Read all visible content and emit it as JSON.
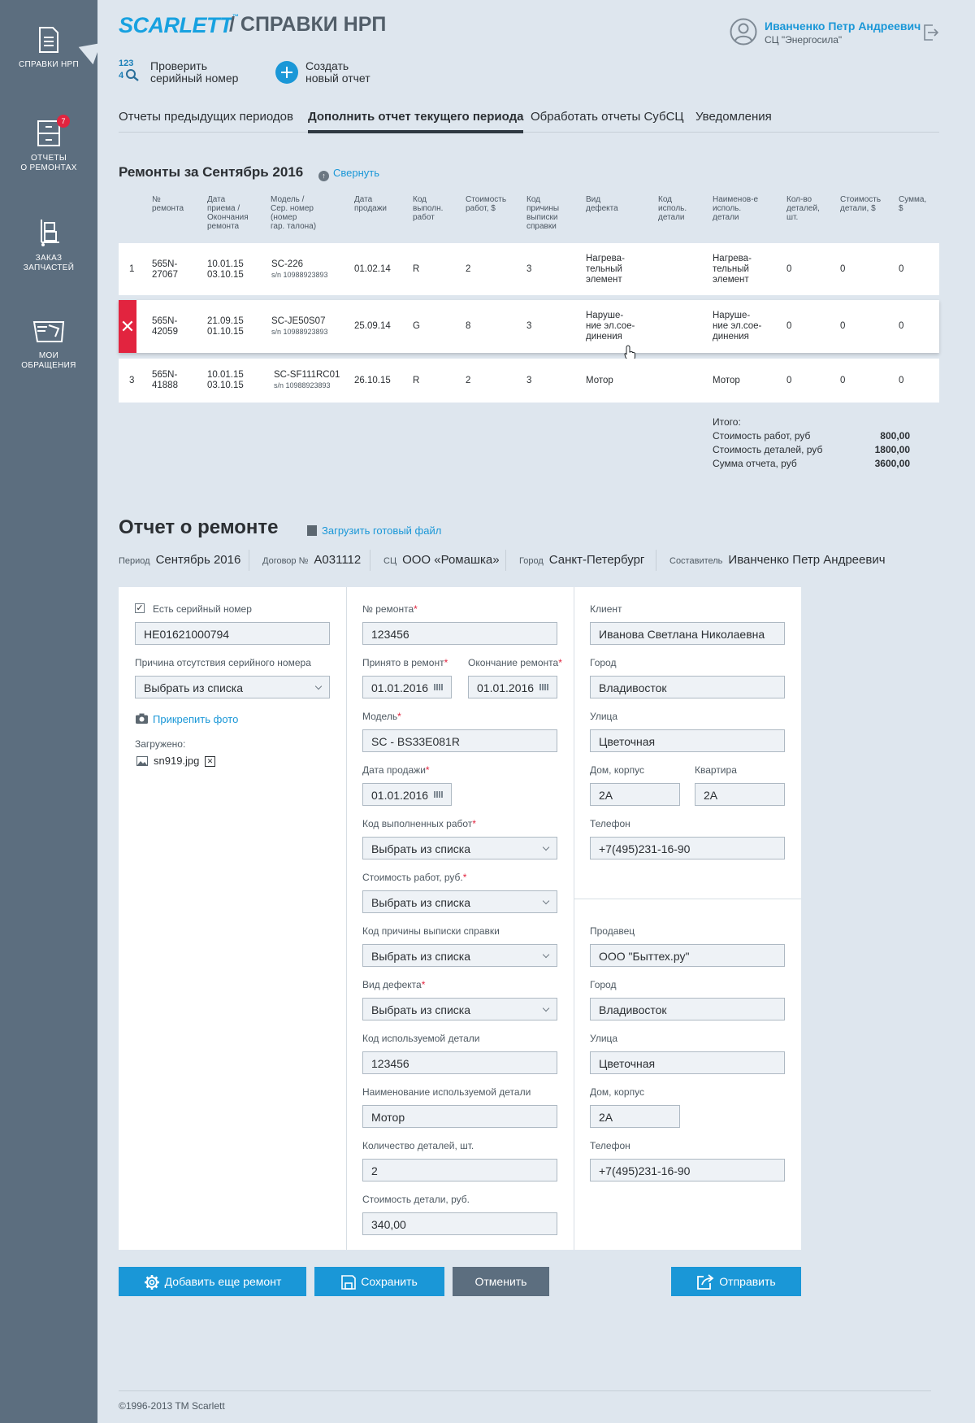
{
  "sidebar": {
    "items": [
      {
        "label": "СПРАВКИ НРП",
        "icon": "document-icon"
      },
      {
        "label": "ОТЧЕТЫ\nО РЕМОНТАХ",
        "icon": "cabinet-icon",
        "badge": "7"
      },
      {
        "label": "ЗАКАЗ\nЗАПЧАСТЕЙ",
        "icon": "hand-truck-icon"
      },
      {
        "label": "МОИ\nОБРАЩЕНИЯ",
        "icon": "inbox-icon"
      }
    ]
  },
  "header": {
    "logo": "SCARLETT",
    "logo_tm": "™",
    "title": "/ СПРАВКИ НРП",
    "user_name": "Иванченко Петр Андреевич",
    "user_org": "СЦ \"Энергосила\""
  },
  "actions": {
    "check_icon_text": "123",
    "check_line1": "Проверить",
    "check_line2": "серийный номер",
    "create_line1": "Создать",
    "create_line2": "новый отчет"
  },
  "tabs": [
    {
      "label": "Отчеты предыдущих периодов"
    },
    {
      "label": "Дополнить отчет текущего периода",
      "active": true
    },
    {
      "label": "Обработать отчеты СубСЦ"
    },
    {
      "label": "Уведомления"
    }
  ],
  "repairs": {
    "title": "Ремонты за Сентябрь 2016",
    "collapse_label": "Свернуть",
    "headers": [
      "№\nремонта",
      "Дата\nприема /\nОкончания\nремонта",
      "Модель /\nСер. номер\n(номер\nгар. талона)",
      "Дата\nпродажи",
      "Код\nвыполн.\nработ",
      "Стоимость\nработ, $",
      "Код\nпричины\nвыписки\nсправки",
      "Вид\nдефекта",
      "Код\nисполь.\nдетали",
      "Наименов-е\nисполь.\nдетали",
      "Кол-во\nдеталей,\nшт.",
      "Стоимость\nдетали, $",
      "Сумма,\n$"
    ],
    "rows": [
      {
        "num": "1",
        "repair_no": "565N-\n27067",
        "dates": "10.01.15\n03.10.15",
        "model": "SC-226",
        "serial": "s/n 10988923893",
        "sale_date": "01.02.14",
        "work_code": "R",
        "work_cost": "2",
        "reason_code": "3",
        "defect": "Нагрева-\nтельный\nэлемент",
        "part_code": "",
        "part_name": "Нагрева-\nтельный\nэлемент",
        "qty": "0",
        "part_cost": "0",
        "sum": "0"
      },
      {
        "num": "",
        "repair_no": "565N-\n42059",
        "dates": "21.09.15\n01.10.15",
        "model": "SC-JE50S07",
        "serial": "s/n 10988923893",
        "sale_date": "25.09.14",
        "work_code": "G",
        "work_cost": "8",
        "reason_code": "3",
        "defect": "Наруше-\nние эл.сое-\nдинения",
        "part_code": "",
        "part_name": "Наруше-\nние эл.сое-\nдинения",
        "qty": "0",
        "part_cost": "0",
        "sum": "0",
        "delete_glyph": "✕"
      },
      {
        "num": "3",
        "repair_no": "565N-\n41888",
        "dates": "10.01.15\n03.10.15",
        "model": "SC-SF111RC01",
        "serial": "s/n 10988923893",
        "sale_date": "26.10.15",
        "work_code": "R",
        "work_cost": "2",
        "reason_code": "3",
        "defect": "Мотор",
        "part_code": "",
        "part_name": "Мотор",
        "qty": "0",
        "part_cost": "0",
        "sum": "0"
      }
    ],
    "totals": {
      "heading": "Итого:",
      "work_label": "Стоимость работ, руб",
      "work_value": "800,00",
      "parts_label": "Стоимость деталей, руб",
      "parts_value": "1800,00",
      "sum_label": "Сумма отчета, руб",
      "sum_value": "3600,00"
    }
  },
  "report": {
    "title": "Отчет о ремонте",
    "upload_label": "Загрузить готовый файл",
    "meta": [
      {
        "label": "Период",
        "value": "Сентябрь 2016"
      },
      {
        "label": "Договор №",
        "value": "A031112"
      },
      {
        "label": "СЦ",
        "value": "ООО «Ромашка»"
      },
      {
        "label": "Город",
        "value": "Санкт-Петербург"
      },
      {
        "label": "Составитель",
        "value": "Иванченко Петр Андреевич"
      }
    ],
    "col1": {
      "has_serial_label": "Есть серийный номер",
      "has_serial_checked": "✓",
      "serial_value": "HE01621000794",
      "no_serial_reason_label": "Причина отсутствия серийного номера",
      "no_serial_reason_value": "Выбрать из списка",
      "attach_photo_label": "Прикрепить фото",
      "uploaded_label": "Загружено:",
      "uploaded_file": "sn919.jpg",
      "remove_glyph": "✕"
    },
    "col2": {
      "repair_no_label": "№ ремонта",
      "repair_no_value": "123456",
      "accepted_label": "Принято в ремонт",
      "accepted_value": "01.01.2016",
      "finished_label": "Окончание ремонта",
      "finished_value": "01.01.2016",
      "model_label": "Модель",
      "model_value": "SC - BS33E081R",
      "sale_date_label": "Дата продажи",
      "sale_date_value": "01.01.2016",
      "work_code_label": "Код выполненных работ",
      "work_code_value": "Выбрать из списка",
      "work_cost_label": "Стоимость работ, руб.",
      "work_cost_value": "Выбрать из списка",
      "reason_code_label": "Код причины выписки справки",
      "reason_code_value": "Выбрать из списка",
      "defect_label": "Вид дефекта",
      "defect_value": "Выбрать из списка",
      "part_code_label": "Код используемой детали",
      "part_code_value": "123456",
      "part_name_label": "Наименование используемой детали",
      "part_name_value": "Мотор",
      "qty_label": "Количество деталей, шт.",
      "qty_value": "2",
      "part_cost_label": "Стоимость детали, руб.",
      "part_cost_value": "340,00",
      "required_mark": "*"
    },
    "col3": {
      "client_label": "Клиент",
      "client_value": "Иванова Светлана Николаевна",
      "city_label": "Город",
      "city_value": "Владивосток",
      "street_label": "Улица",
      "street_value": "Цветочная",
      "house_label": "Дом, корпус",
      "house_value": "2А",
      "flat_label": "Квартира",
      "flat_value": "2А",
      "phone_label": "Телефон",
      "phone_value": "+7(495)231-16-90",
      "seller_label": "Продавец",
      "seller_value": "ООО \"Быттех.ру\"",
      "seller_city_label": "Город",
      "seller_city_value": "Владивосток",
      "seller_street_label": "Улица",
      "seller_street_value": "Цветочная",
      "seller_house_label": "Дом, корпус",
      "seller_house_value": "2А",
      "seller_phone_label": "Телефон",
      "seller_phone_value": "+7(495)231-16-90"
    },
    "buttons": {
      "add": "Добавить еще ремонт",
      "save": "Сохранить",
      "cancel": "Отменить",
      "send": "Отправить"
    }
  },
  "footer": {
    "copyright": "©1996-2013 TM Scarlett"
  },
  "colors": {
    "accent": "#1a97d7",
    "sidebar": "#5c6e7f",
    "danger": "#e2243f",
    "background": "#dee6ee"
  }
}
